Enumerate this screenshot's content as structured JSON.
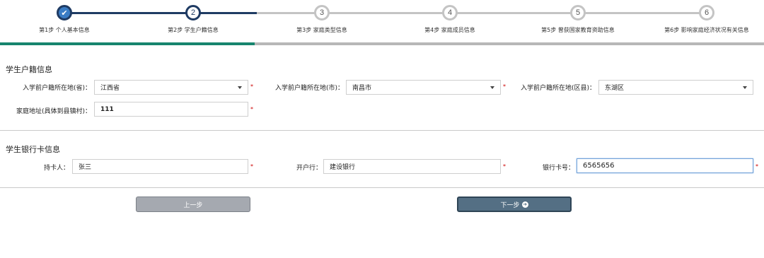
{
  "wizard": {
    "steps": [
      {
        "number": "✔",
        "label": "第1步 个人基本信息",
        "state": "done"
      },
      {
        "number": "2",
        "label": "第2步 学生户籍信息",
        "state": "active"
      },
      {
        "number": "3",
        "label": "第3步 家庭类型信息",
        "state": "todo"
      },
      {
        "number": "4",
        "label": "第4步 家庭成员信息",
        "state": "todo"
      },
      {
        "number": "5",
        "label": "第5步 曾获国家教育资助信息",
        "state": "todo"
      },
      {
        "number": "6",
        "label": "第6步 影响家庭经济状况有关信息",
        "state": "todo"
      }
    ],
    "progress_fraction": 0.333
  },
  "household": {
    "title": "学生户籍信息",
    "province_label": "入学前户籍所在地(省)：",
    "province_value": "江西省",
    "city_label": "入学前户籍所在地(市)：",
    "city_value": "南昌市",
    "district_label": "入学前户籍所在地(区县)：",
    "district_value": "东湖区",
    "address_label": "家庭地址(具体到县镇村)：",
    "address_value": "111",
    "required_mark": "*"
  },
  "bank": {
    "title": "学生银行卡信息",
    "holder_label": "持卡人：",
    "holder_value": "张三",
    "bank_label": "开户行：",
    "bank_value": "建设银行",
    "card_label": "银行卡号：",
    "card_value": "6565656"
  },
  "buttons": {
    "prev_label": "上一步",
    "next_label": "下一步"
  },
  "colors": {
    "done_step": "#3a7cc4",
    "step_border_active": "#1f3b63",
    "progress_fill": "#17856e",
    "next_button": "#546f84",
    "prev_button": "#a5a9b0"
  }
}
